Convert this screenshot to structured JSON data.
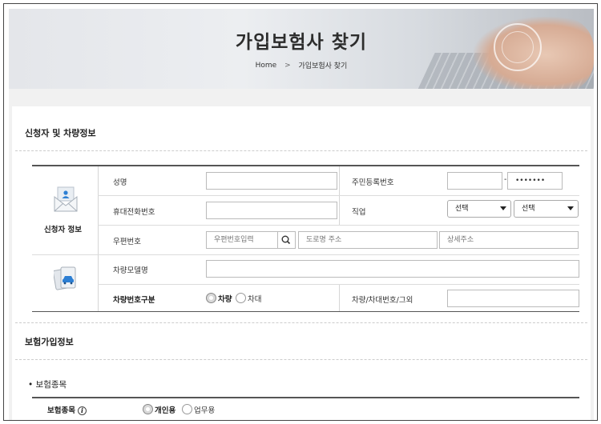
{
  "hero": {
    "title": "가입보험사 찾기"
  },
  "breadcrumb": {
    "home": "Home",
    "separator": ">",
    "current": "가입보험사 찾기"
  },
  "applicant_section": {
    "title": "신청자 및 차량정보"
  },
  "applicant_box": {
    "label": "신청자 정보",
    "icon": "envelope-user-icon"
  },
  "vehicle_box": {
    "icon": "vehicle-documents-icon"
  },
  "fields": {
    "name": {
      "label": "성명",
      "value": ""
    },
    "rrn": {
      "label": "주민등록번호",
      "front": "",
      "separator": "-",
      "back": "•••••••"
    },
    "phone": {
      "label": "휴대전화번호",
      "value": ""
    },
    "job": {
      "label": "직업",
      "select1": "선택",
      "select2": "선택"
    },
    "postal": {
      "label": "우편번호",
      "zip_placeholder": "우편번호입력",
      "road_placeholder": "도로명 주소",
      "detail_placeholder": "상세주소"
    },
    "model": {
      "label": "차량모델명",
      "value": ""
    },
    "vehicle_type": {
      "label": "차량번호구분",
      "options": [
        "차량",
        "차대"
      ],
      "selected": "차량"
    },
    "vehicle_number": {
      "label": "차량/차대번호/그외",
      "value": ""
    }
  },
  "insurance_section": {
    "title": "보험가입정보"
  },
  "insurance_type": {
    "subtitle": "• 보험종목",
    "label": "보험종목",
    "options": [
      "개인용",
      "업무용"
    ],
    "selected": "개인용"
  }
}
